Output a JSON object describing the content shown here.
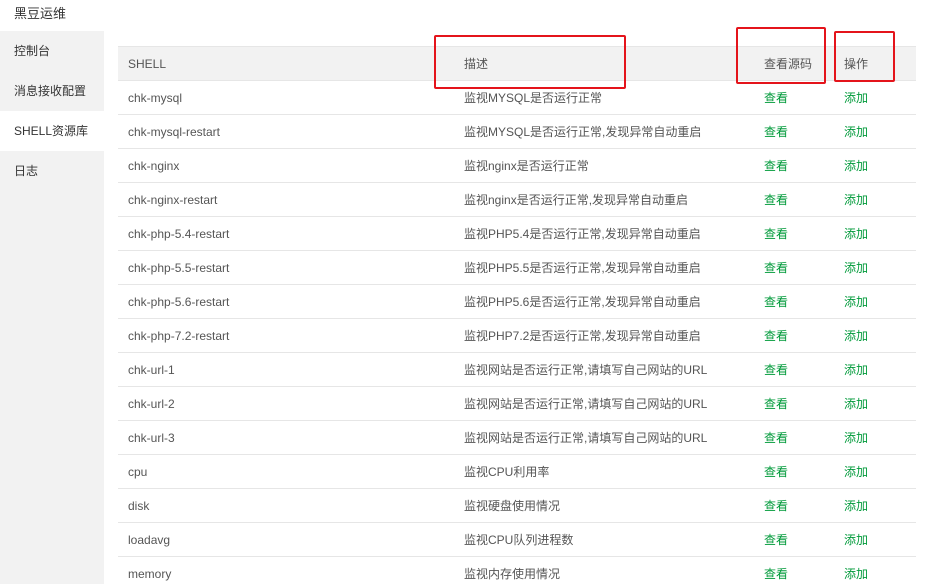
{
  "app": {
    "title": "黑豆运维"
  },
  "sidebar": {
    "items": [
      {
        "label": "控制台",
        "active": false
      },
      {
        "label": "消息接收配置",
        "active": false
      },
      {
        "label": "SHELL资源库",
        "active": true
      },
      {
        "label": "日志",
        "active": false
      }
    ]
  },
  "table": {
    "headers": {
      "shell": "SHELL",
      "desc": "描述",
      "view": "查看源码",
      "op": "操作"
    },
    "view_label": "查看",
    "add_label": "添加",
    "rows": [
      {
        "shell": "chk-mysql",
        "desc": "监视MYSQL是否运行正常"
      },
      {
        "shell": "chk-mysql-restart",
        "desc": "监视MYSQL是否运行正常,发现异常自动重启"
      },
      {
        "shell": "chk-nginx",
        "desc": "监视nginx是否运行正常"
      },
      {
        "shell": "chk-nginx-restart",
        "desc": "监视nginx是否运行正常,发现异常自动重启"
      },
      {
        "shell": "chk-php-5.4-restart",
        "desc": "监视PHP5.4是否运行正常,发现异常自动重启"
      },
      {
        "shell": "chk-php-5.5-restart",
        "desc": "监视PHP5.5是否运行正常,发现异常自动重启"
      },
      {
        "shell": "chk-php-5.6-restart",
        "desc": "监视PHP5.6是否运行正常,发现异常自动重启"
      },
      {
        "shell": "chk-php-7.2-restart",
        "desc": "监视PHP7.2是否运行正常,发现异常自动重启"
      },
      {
        "shell": "chk-url-1",
        "desc": "监视网站是否运行正常,请填写自己网站的URL"
      },
      {
        "shell": "chk-url-2",
        "desc": "监视网站是否运行正常,请填写自己网站的URL"
      },
      {
        "shell": "chk-url-3",
        "desc": "监视网站是否运行正常,请填写自己网站的URL"
      },
      {
        "shell": "cpu",
        "desc": "监视CPU利用率"
      },
      {
        "shell": "disk",
        "desc": "监视硬盘使用情况"
      },
      {
        "shell": "loadavg",
        "desc": "监视CPU队列进程数"
      },
      {
        "shell": "memory",
        "desc": "监视内存使用情况"
      }
    ]
  },
  "colors": {
    "link": "#009a3a",
    "highlight": "#e4141b",
    "sidebar_bg": "#f2f2f2"
  }
}
